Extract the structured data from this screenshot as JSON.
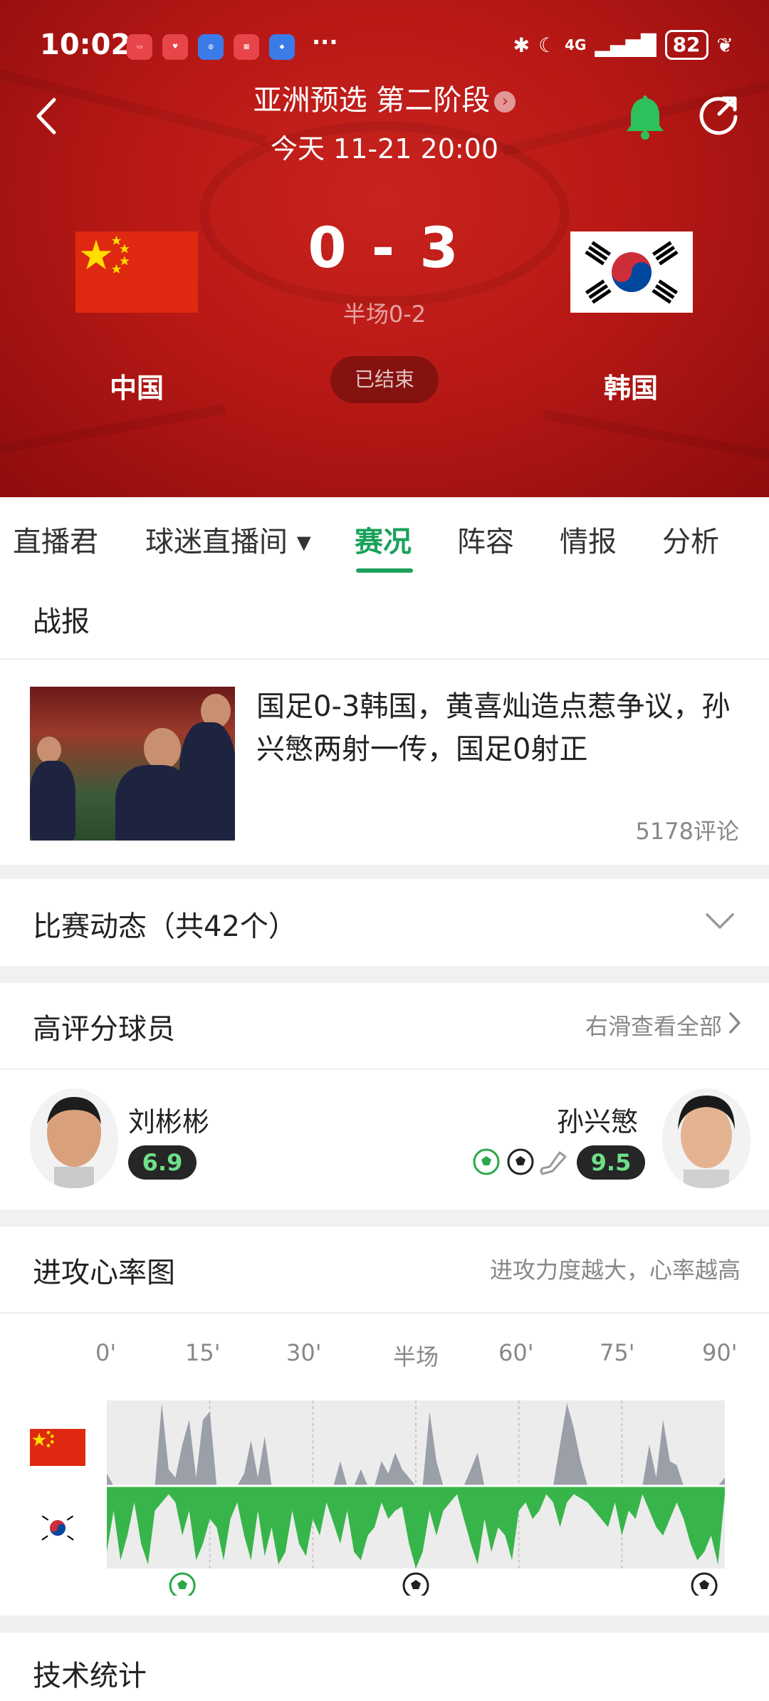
{
  "status_bar": {
    "time": "10:02",
    "dots": "···",
    "network": "4G",
    "battery": "82"
  },
  "header": {
    "competition": "亚洲预选 第二阶段",
    "datetime": "今天 11-21 20:00",
    "chevron": "›"
  },
  "match": {
    "home": "中国",
    "away": "韩国",
    "home_score": "0",
    "away_score": "3",
    "score": "0 - 3",
    "half_time": "半场0-2",
    "status": "已结束"
  },
  "tabs": [
    {
      "label": "直播君"
    },
    {
      "label": "球迷直播间 ▾"
    },
    {
      "label": "赛况"
    },
    {
      "label": "阵容"
    },
    {
      "label": "情报"
    },
    {
      "label": "分析"
    }
  ],
  "report": {
    "section_title": "战报",
    "headline": "国足0-3韩国，黄喜灿造点惹争议，孙兴慜两射一传，国足0射正",
    "comments": "5178评论"
  },
  "events": {
    "title": "比赛动态（共42个）"
  },
  "top_players": {
    "title": "高评分球员",
    "hint": "右滑查看全部",
    "home_player": {
      "name": "刘彬彬",
      "rating": "6.9"
    },
    "away_player": {
      "name": "孙兴慜",
      "rating": "9.5",
      "icons": [
        "goal-icon-green",
        "goal-icon",
        "boot-icon"
      ]
    }
  },
  "attack_chart": {
    "title": "进攻心率图",
    "hint": "进攻力度越大，心率越高",
    "time_labels": [
      "0'",
      "15'",
      "30'",
      "半场",
      "60'",
      "75'",
      "90'"
    ],
    "home_goals": [],
    "away_goal_minutes": [
      11,
      45,
      87
    ]
  },
  "chart_data": {
    "type": "area",
    "title": "进攻心率图",
    "x_ticks": [
      "0'",
      "15'",
      "30'",
      "半场",
      "60'",
      "75'",
      "90'"
    ],
    "xlim": [
      0,
      90
    ],
    "series": [
      {
        "team": "home",
        "color": "#9a9fa8",
        "x": [
          0,
          1,
          2,
          3,
          4,
          5,
          6,
          7,
          8,
          9,
          10,
          11,
          12,
          13,
          14,
          15,
          16,
          17,
          18,
          19,
          20,
          21,
          22,
          23,
          24,
          25,
          26,
          27,
          28,
          29,
          30,
          31,
          32,
          33,
          34,
          35,
          36,
          37,
          38,
          39,
          40,
          41,
          42,
          43,
          44,
          45,
          46,
          47,
          48,
          49,
          50,
          51,
          52,
          53,
          54,
          55,
          56,
          57,
          58,
          59,
          60,
          61,
          62,
          63,
          64,
          65,
          66,
          67,
          68,
          69,
          70,
          71,
          72,
          73,
          74,
          75,
          76,
          77,
          78,
          79,
          80,
          81,
          82,
          83,
          84,
          85,
          86,
          87,
          88,
          89,
          90
        ],
        "values": [
          0.15,
          0,
          0,
          0,
          0,
          0,
          0,
          0,
          1.0,
          0.2,
          0.1,
          0.5,
          0.8,
          0.1,
          0.8,
          0.9,
          0,
          0,
          0,
          0,
          0.15,
          0.55,
          0.1,
          0.6,
          0,
          0,
          0,
          0,
          0,
          0,
          0,
          0,
          0,
          0,
          0.3,
          0,
          0,
          0.2,
          0,
          0,
          0.3,
          0.15,
          0.4,
          0.2,
          0.1,
          0,
          0,
          0.9,
          0.3,
          0,
          0,
          0,
          0,
          0.2,
          0.4,
          0,
          0,
          0,
          0,
          0,
          0,
          0,
          0,
          0,
          0,
          0,
          0.5,
          1.0,
          0.7,
          0.3,
          0,
          0,
          0,
          0,
          0,
          0,
          0,
          0,
          0,
          0.5,
          0.1,
          0.8,
          0.3,
          0.25,
          0,
          0,
          0,
          0,
          0,
          0,
          0.1
        ]
      },
      {
        "team": "away",
        "color": "#38b54a",
        "x": [
          0,
          1,
          2,
          3,
          4,
          5,
          6,
          7,
          8,
          9,
          10,
          11,
          12,
          13,
          14,
          15,
          16,
          17,
          18,
          19,
          20,
          21,
          22,
          23,
          24,
          25,
          26,
          27,
          28,
          29,
          30,
          31,
          32,
          33,
          34,
          35,
          36,
          37,
          38,
          39,
          40,
          41,
          42,
          43,
          44,
          45,
          46,
          47,
          48,
          49,
          50,
          51,
          52,
          53,
          54,
          55,
          56,
          57,
          58,
          59,
          60,
          61,
          62,
          63,
          64,
          65,
          66,
          67,
          68,
          69,
          70,
          71,
          72,
          73,
          74,
          75,
          76,
          77,
          78,
          79,
          80,
          81,
          82,
          83,
          84,
          85,
          86,
          87,
          88,
          89,
          90
        ],
        "values": [
          0.8,
          0.3,
          0.9,
          0.6,
          0.2,
          0.7,
          0.95,
          0.3,
          0.2,
          0.1,
          0.2,
          0.6,
          0.3,
          0.9,
          0.7,
          0.4,
          0.5,
          0.9,
          0.4,
          0.2,
          0.6,
          0.9,
          0.3,
          0.85,
          0.5,
          0.95,
          0.8,
          0.3,
          0.7,
          0.85,
          0.4,
          0.6,
          0.2,
          0.45,
          0.7,
          0.3,
          0.8,
          0.9,
          0.6,
          0.5,
          0.2,
          0.4,
          0.3,
          0.25,
          0.7,
          1.0,
          0.8,
          0.3,
          0.6,
          0.3,
          0.2,
          0.1,
          0.4,
          0.7,
          0.95,
          0.4,
          0.8,
          0.5,
          0.6,
          0.9,
          0.3,
          0.2,
          0.4,
          0.3,
          0.1,
          0.2,
          0.5,
          0.2,
          0.1,
          0.15,
          0.2,
          0.3,
          0.4,
          0.5,
          0.2,
          0.6,
          0.3,
          0.4,
          0.1,
          0.3,
          0.5,
          0.6,
          0.4,
          0.2,
          0.4,
          0.7,
          0.9,
          0.8,
          0.6,
          0.95,
          0.1
        ]
      }
    ]
  },
  "stats": {
    "title": "技术统计"
  }
}
